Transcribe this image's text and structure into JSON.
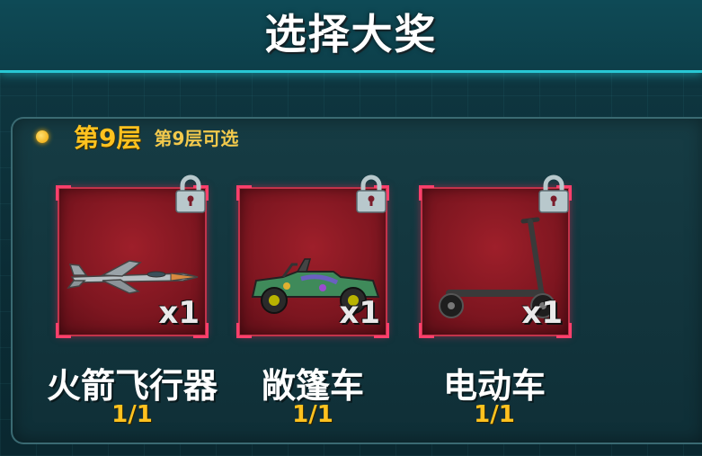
{
  "header": {
    "title": "选择大奖"
  },
  "tier": {
    "label": "第9层",
    "hint": "第9层可选"
  },
  "rewards": [
    {
      "name": "火箭飞行器",
      "quantity": "x1",
      "count": "1/1",
      "icon": "rocket-jet-icon",
      "locked": true
    },
    {
      "name": "敞篷车",
      "quantity": "x1",
      "count": "1/1",
      "icon": "convertible-car-icon",
      "locked": true
    },
    {
      "name": "电动车",
      "quantity": "x1",
      "count": "1/1",
      "icon": "electric-scooter-icon",
      "locked": true
    }
  ],
  "colors": {
    "accent": "#28c7d4",
    "gold": "#ffc21f",
    "card": "#9e1f2a"
  }
}
